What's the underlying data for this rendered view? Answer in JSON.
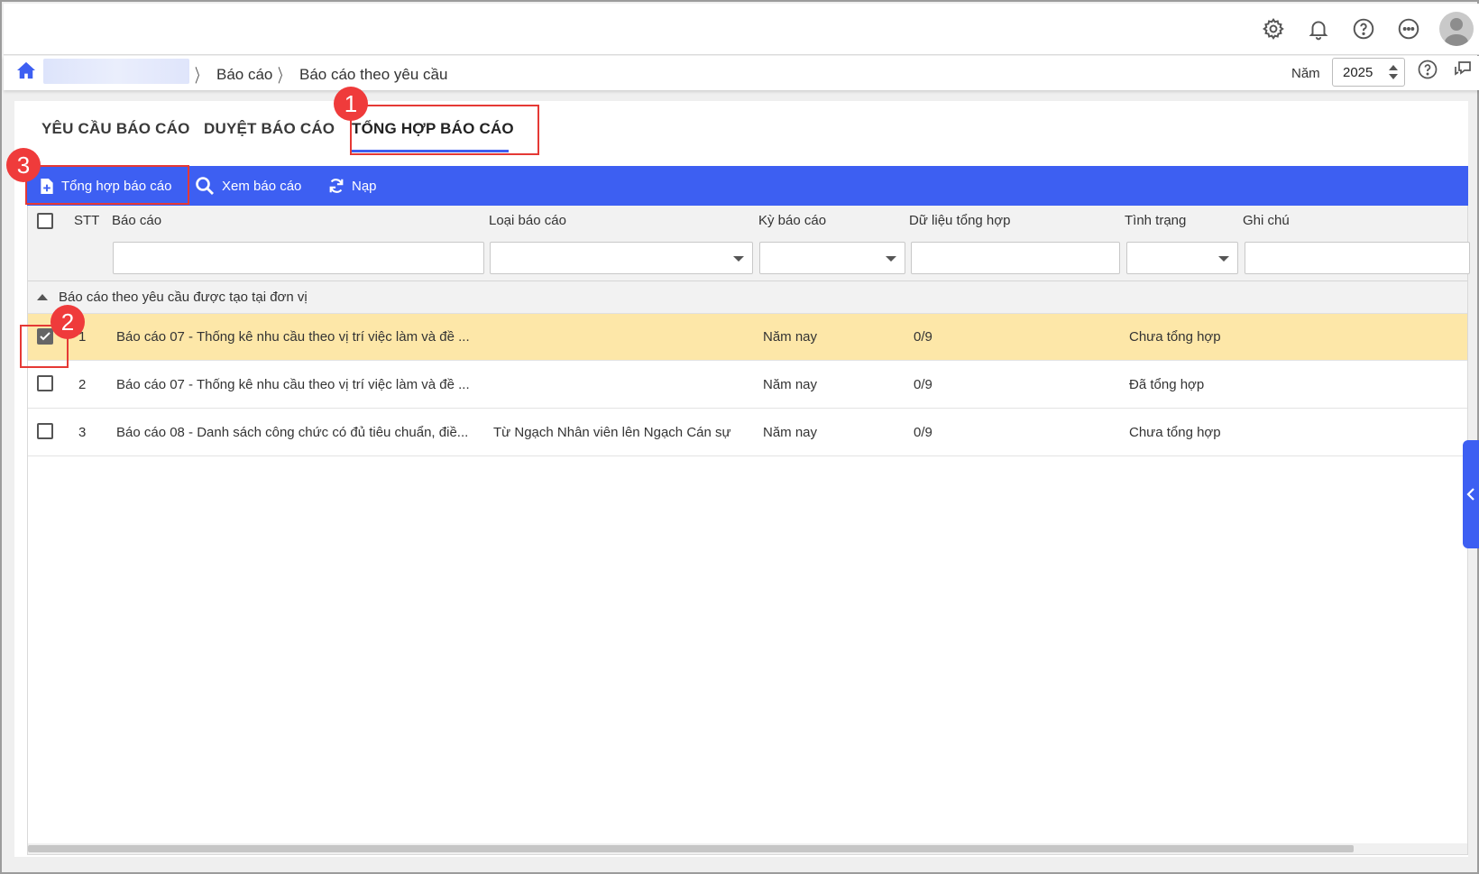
{
  "topbar": {
    "icons": [
      "gear-icon",
      "bell-icon",
      "help-circle-icon",
      "more-icon",
      "avatar"
    ]
  },
  "breadcrumb": {
    "items": [
      "Báo cáo",
      "Báo cáo theo yêu cầu"
    ],
    "year_label": "Năm",
    "year_value": "2025"
  },
  "tabs": [
    {
      "label": "YÊU CẦU BÁO CÁO",
      "active": false
    },
    {
      "label": "DUYỆT BÁO CÁO",
      "active": false
    },
    {
      "label": "TỔNG HỢP BÁO CÁO",
      "active": true
    }
  ],
  "toolbar": {
    "synthesize_label": "Tổng hợp báo cáo",
    "view_label": "Xem báo cáo",
    "reload_label": "Nạp"
  },
  "grid": {
    "columns": [
      "STT",
      "Báo cáo",
      "Loại báo cáo",
      "Kỳ báo cáo",
      "Dữ liệu tổng hợp",
      "Tình trạng",
      "Ghi chú"
    ],
    "group_label": "Báo cáo theo yêu cầu được tạo tại đơn vị",
    "rows": [
      {
        "stt": "1",
        "report": "Báo cáo 07 - Thống kê nhu cầu theo vị trí việc làm và đề ...",
        "type": "",
        "period": "Năm nay",
        "data": "0/9",
        "status": "Chưa tổng hợp",
        "note": "",
        "selected": true
      },
      {
        "stt": "2",
        "report": "Báo cáo 07 - Thống kê nhu cầu theo vị trí việc làm và đề ...",
        "type": "",
        "period": "Năm nay",
        "data": "0/9",
        "status": "Đã tổng hợp",
        "note": "",
        "selected": false
      },
      {
        "stt": "3",
        "report": "Báo cáo 08 - Danh sách công chức có đủ tiêu chuẩn, điề...",
        "type": "Từ Ngạch Nhân viên lên Ngạch Cán sự",
        "period": "Năm nay",
        "data": "0/9",
        "status": "Chưa tổng hợp",
        "note": "",
        "selected": false
      }
    ]
  },
  "annotations": [
    "1",
    "2",
    "3"
  ],
  "colors": {
    "accent": "#3d5ff2",
    "selected_row": "#fde7a8",
    "marker": "#ef3b3b"
  }
}
